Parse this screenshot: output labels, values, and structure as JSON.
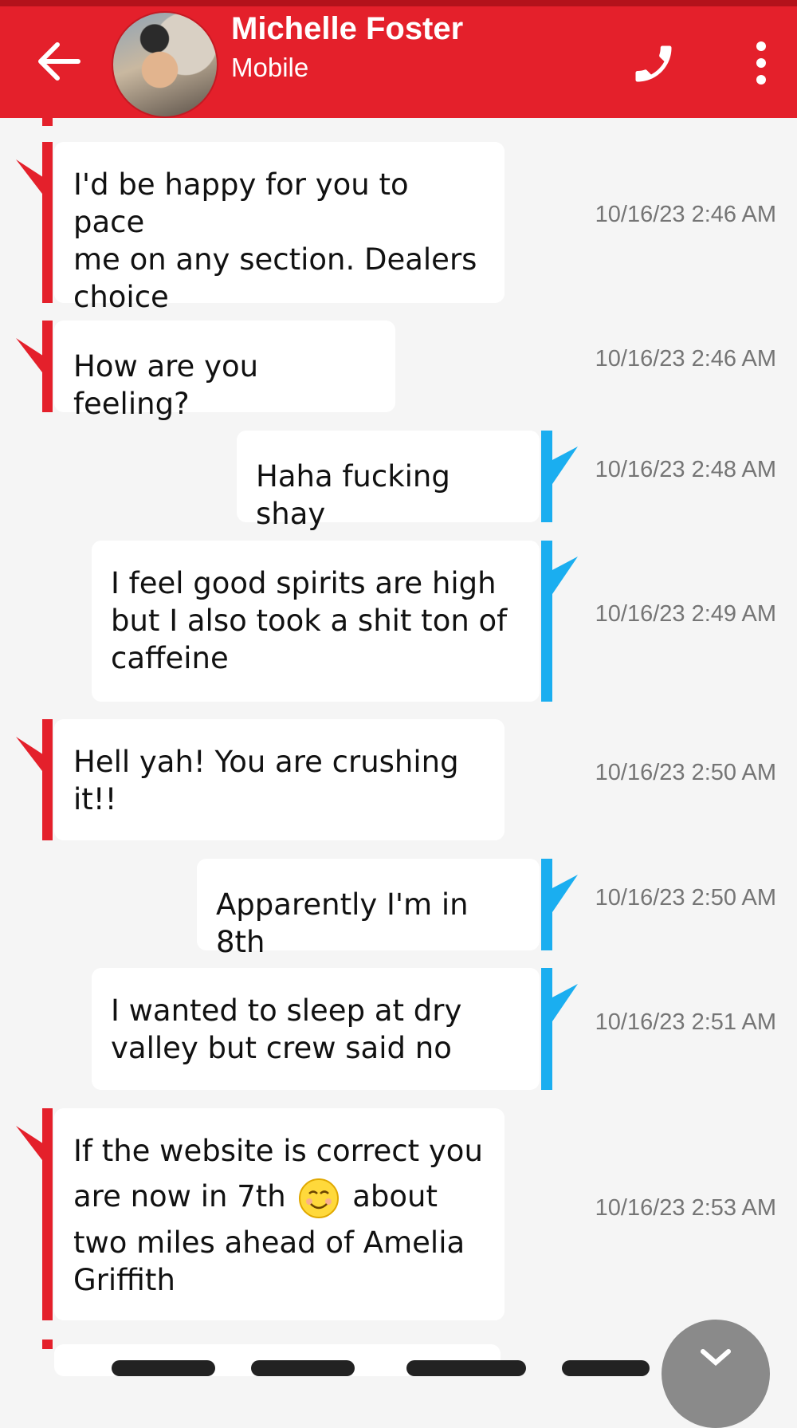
{
  "header": {
    "contact_name": "Michelle Foster",
    "contact_sub": "Mobile",
    "accent_color": "#e4202b",
    "icons": [
      "back-arrow-icon",
      "phone-icon",
      "more-vertical-icon"
    ]
  },
  "messages": [
    {
      "direction": "incoming",
      "text_lines": [
        "I'd be happy for you to pace",
        "me on any section. Dealers",
        "choice"
      ],
      "timestamp": "10/16/23 2:46 AM"
    },
    {
      "direction": "incoming",
      "text_lines": [
        "How are you feeling?"
      ],
      "timestamp": "10/16/23 2:46 AM"
    },
    {
      "direction": "outgoing",
      "text_lines": [
        "Haha fucking shay"
      ],
      "timestamp": "10/16/23 2:48 AM"
    },
    {
      "direction": "outgoing",
      "text_lines": [
        "I feel good spirits are high",
        "but I also took a shit ton of",
        "caffeine"
      ],
      "timestamp": "10/16/23 2:49 AM"
    },
    {
      "direction": "incoming",
      "text_lines": [
        "Hell yah! You are crushing",
        "it!!"
      ],
      "timestamp": "10/16/23 2:50 AM"
    },
    {
      "direction": "outgoing",
      "text_lines": [
        "Apparently I'm in 8th"
      ],
      "timestamp": "10/16/23 2:50 AM"
    },
    {
      "direction": "outgoing",
      "text_lines": [
        "I wanted to sleep at dry",
        "valley but crew said no"
      ],
      "timestamp": "10/16/23 2:51 AM"
    },
    {
      "direction": "incoming",
      "text_lines": [
        "If the website is correct you",
        "are now in 7th",
        "about",
        "two miles ahead of Amelia",
        "Griffith"
      ],
      "emoji": "smiling-face-emoji",
      "timestamp": "10/16/23 2:53 AM"
    }
  ],
  "colors": {
    "incoming_bar": "#e4202b",
    "outgoing_bar": "#1aaef0",
    "timestamp": "#757575"
  }
}
